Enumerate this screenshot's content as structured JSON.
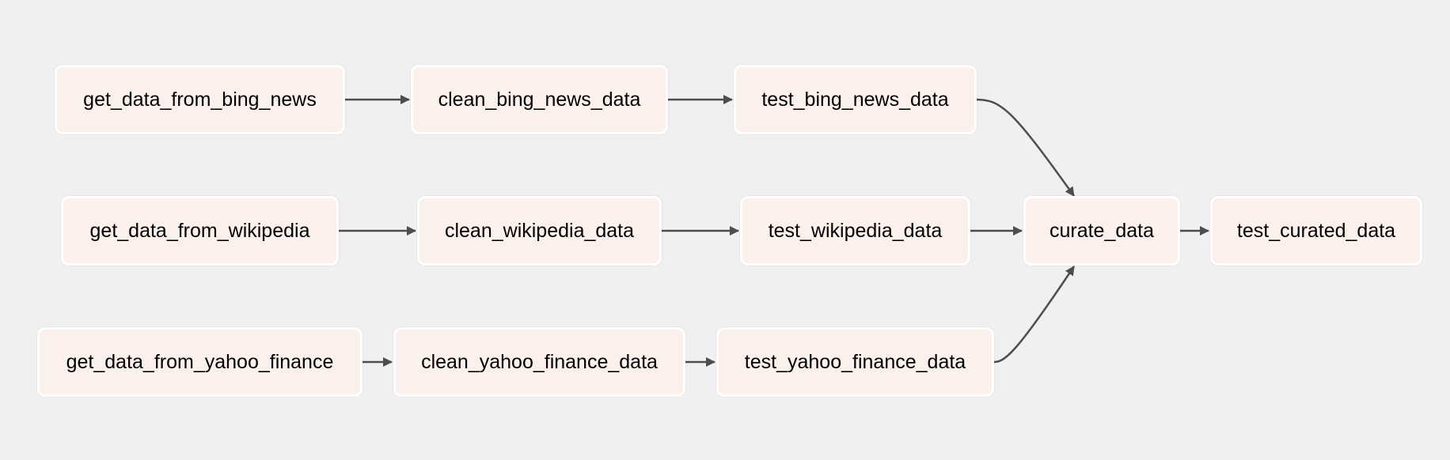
{
  "dag": {
    "tasks": {
      "get_bing": "get_data_from_bing_news",
      "clean_bing": "clean_bing_news_data",
      "test_bing": "test_bing_news_data",
      "get_wiki": "get_data_from_wikipedia",
      "clean_wiki": "clean_wikipedia_data",
      "test_wiki": "test_wikipedia_data",
      "get_yahoo": "get_data_from_yahoo_finance",
      "clean_yahoo": "clean_yahoo_finance_data",
      "test_yahoo": "test_yahoo_finance_data",
      "curate": "curate_data",
      "test_curated": "test_curated_data"
    },
    "edges": [
      [
        "get_data_from_bing_news",
        "clean_bing_news_data"
      ],
      [
        "clean_bing_news_data",
        "test_bing_news_data"
      ],
      [
        "test_bing_news_data",
        "curate_data"
      ],
      [
        "get_data_from_wikipedia",
        "clean_wikipedia_data"
      ],
      [
        "clean_wikipedia_data",
        "test_wikipedia_data"
      ],
      [
        "test_wikipedia_data",
        "curate_data"
      ],
      [
        "get_data_from_yahoo_finance",
        "clean_yahoo_finance_data"
      ],
      [
        "clean_yahoo_finance_data",
        "test_yahoo_finance_data"
      ],
      [
        "test_yahoo_finance_data",
        "curate_data"
      ],
      [
        "curate_data",
        "test_curated_data"
      ]
    ],
    "colors": {
      "background": "#f0f0f0",
      "node_fill": "#fbf0ec",
      "node_border": "#ffffff",
      "edge": "#4d4d4d"
    }
  }
}
